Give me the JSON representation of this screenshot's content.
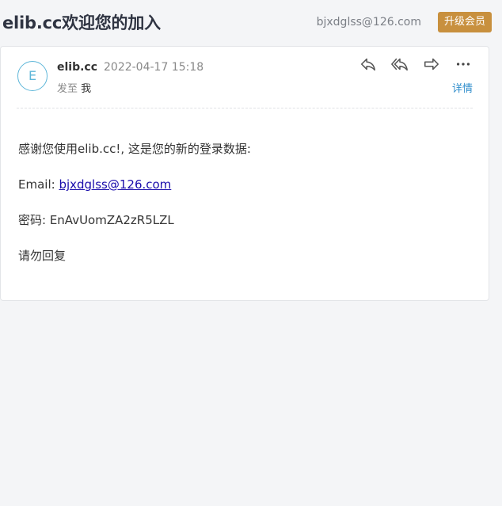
{
  "header": {
    "subject": "elib.cc欢迎您的加入",
    "account_email": "bjxdglss@126.com",
    "upgrade_label": "升级会员",
    "upgrade_color": "#c8903e"
  },
  "mail": {
    "avatar_letter": "E",
    "sender": "elib.cc",
    "time": "2022-04-17 15:18",
    "recipient_label": "发至",
    "recipient": "我",
    "details_label": "详情",
    "toolbar": {
      "reply_icon": "reply-icon",
      "reply_all_icon": "reply-all-icon",
      "forward_icon": "forward-icon",
      "more_icon": "more-icon"
    },
    "body": {
      "greeting": "感谢您使用elib.cc!, 这是您的新的登录数据:",
      "email_label": "Email: ",
      "email_value": "bjxdglss@126.com",
      "password_line": "密码: EnAvUomZA2zR5LZL",
      "no_reply": "请勿回复"
    }
  }
}
